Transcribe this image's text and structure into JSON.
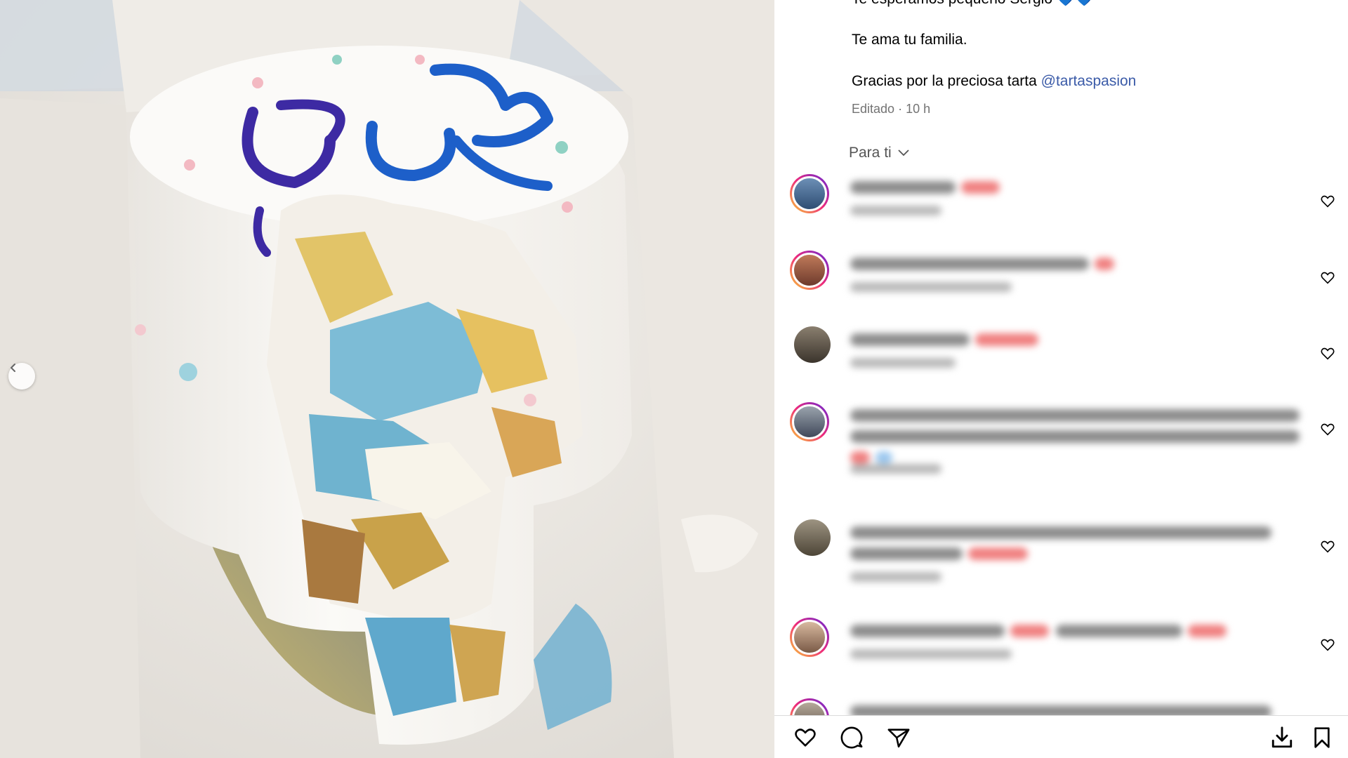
{
  "caption": {
    "line1": "Te esperamos pequeño Sergio 💙💙",
    "line2": "Te ama tu familia.",
    "line3_text": "Gracias por la preciosa tarta ",
    "line3_mention": "@tartaspasion"
  },
  "meta": {
    "edited": "Editado",
    "sep": " · ",
    "time": "10 h"
  },
  "comments_filter": {
    "label": "Para ti"
  },
  "media": {
    "cake_topper_text": "Boy Girl",
    "colors": {
      "frosting": "#f7f5f1",
      "blue_filling": "#6fb3cf",
      "sponge": "#e5c26a",
      "topper_blue": "#1d5fc9",
      "topper_purple": "#3d2aa3",
      "board": "#7f8077"
    }
  },
  "icons": {
    "prev": "chevron-left-icon",
    "like": "heart-icon",
    "comment": "comment-bubble-icon",
    "share": "send-icon",
    "download": "download-icon",
    "save": "bookmark-icon"
  }
}
